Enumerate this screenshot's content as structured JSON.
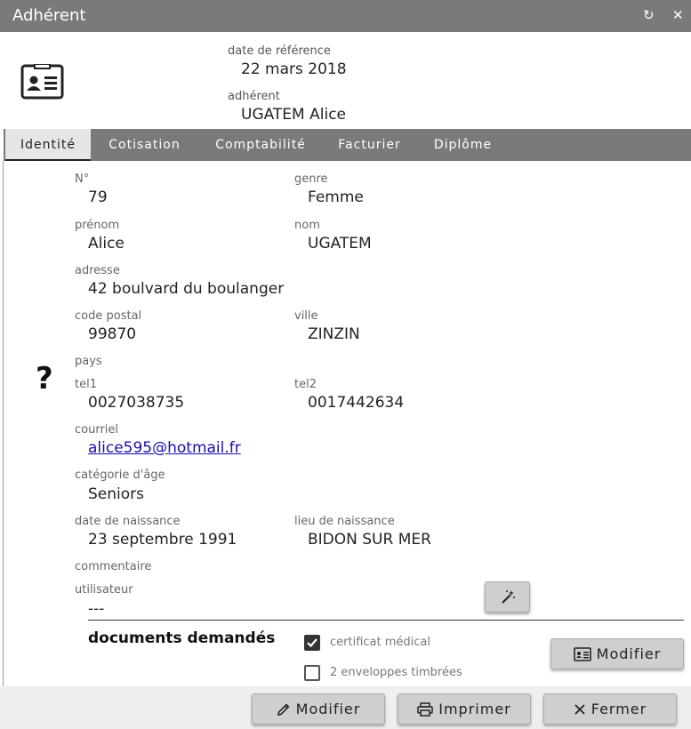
{
  "window": {
    "title": "Adhérent"
  },
  "header": {
    "date_label": "date de référence",
    "date_value": "22 mars 2018",
    "member_label": "adhérent",
    "member_value": "UGATEM Alice"
  },
  "tabs": [
    {
      "label": "Identité",
      "active": true
    },
    {
      "label": "Cotisation",
      "active": false
    },
    {
      "label": "Comptabilité",
      "active": false
    },
    {
      "label": "Facturier",
      "active": false
    },
    {
      "label": "Diplôme",
      "active": false
    }
  ],
  "fields": {
    "numero": {
      "label": "N°",
      "value": "79"
    },
    "genre": {
      "label": "genre",
      "value": "Femme"
    },
    "prenom": {
      "label": "prénom",
      "value": "Alice"
    },
    "nom": {
      "label": "nom",
      "value": "UGATEM"
    },
    "adresse": {
      "label": "adresse",
      "value": "42 boulvard du boulanger"
    },
    "code_postal": {
      "label": "code postal",
      "value": "99870"
    },
    "ville": {
      "label": "ville",
      "value": "ZINZIN"
    },
    "pays": {
      "label": "pays"
    },
    "tel1": {
      "label": "tel1",
      "value": "0027038735"
    },
    "tel2": {
      "label": "tel2",
      "value": "0017442634"
    },
    "courriel": {
      "label": "courriel",
      "value": "alice595@hotmail.fr"
    },
    "categorie_age": {
      "label": "catégorie d'âge",
      "value": "Seniors"
    },
    "date_naissance": {
      "label": "date de naissance",
      "value": "23 septembre 1991"
    },
    "lieu_naissance": {
      "label": "lieu de naissance",
      "value": "BIDON SUR MER"
    },
    "commentaire": {
      "label": "commentaire"
    },
    "utilisateur": {
      "label": "utilisateur",
      "value": "---"
    }
  },
  "documents": {
    "title": "documents demandés",
    "items": [
      {
        "label": "certificat médical",
        "checked": true
      },
      {
        "label": "2 enveloppes timbrées",
        "checked": false
      }
    ],
    "modify_label": "Modifier"
  },
  "footer": {
    "modify_label": "Modifier",
    "print_label": "Imprimer",
    "close_label": "Fermer"
  },
  "icons": {
    "title_refresh": "refresh-icon",
    "title_close": "close-icon",
    "header": "id-card-icon",
    "photo": "question-mark-icon",
    "wand": "magic-wand-icon",
    "pencil": "pencil-icon",
    "printer": "printer-icon",
    "close": "close-icon"
  },
  "colors": {
    "titlebar": "#7a7a7a",
    "link": "#1a0dab",
    "button": "#cfcfcf"
  }
}
